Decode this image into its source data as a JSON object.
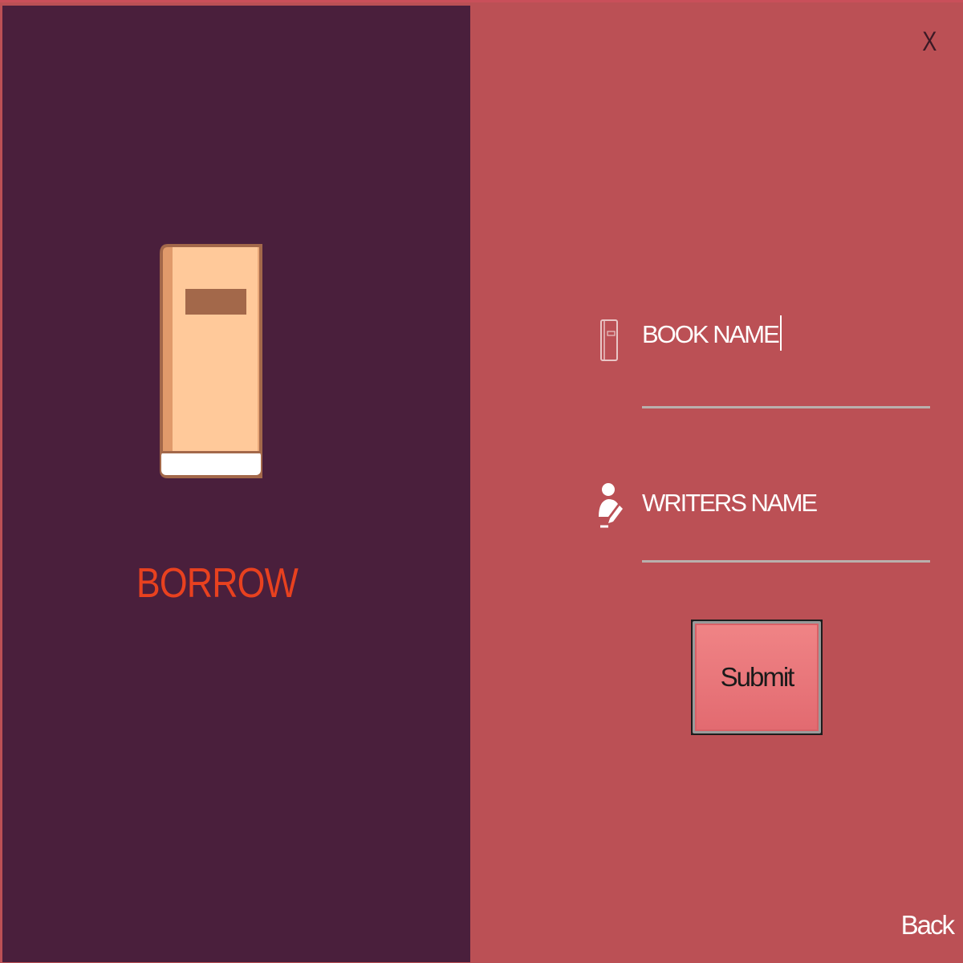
{
  "left_panel": {
    "title": "BORROW",
    "illustration_icon": "book-icon",
    "background_color": "#4a1f3c",
    "title_color": "#e8411f"
  },
  "window": {
    "close_label": "X",
    "back_label": "Back",
    "background_color": "#bb5055"
  },
  "form": {
    "book_name": {
      "placeholder": "BOOK NAME",
      "icon": "book-small-icon",
      "focused": true
    },
    "writers_name": {
      "placeholder": "WRITERS NAME",
      "icon": "writer-icon"
    },
    "submit_label": "Submit",
    "submit_color": "#e97277"
  }
}
